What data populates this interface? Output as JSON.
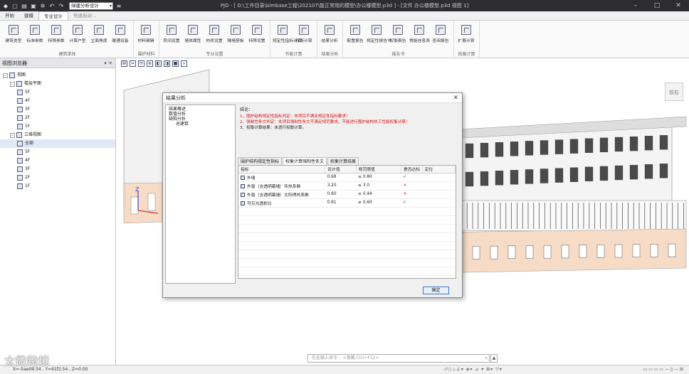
{
  "app": {
    "window_title": "PJD - [ D:\\工作目录\\bimbase工程\\202107\\能正常用的模型\\办公楼模型.p3d ] - [文件 办公楼模型.p3d 视图 1]",
    "workspace_combo": "绿建分析设计"
  },
  "tabs": [
    "开始",
    "建模",
    "专业设计",
    "快速启动..."
  ],
  "ribbon": {
    "groups": [
      {
        "label": "建筑单体",
        "buttons": [
          "建筑类型",
          "标准参数",
          "特殊参数",
          "计算户型",
          "立面角度",
          "暖通设备"
        ]
      },
      {
        "label": "围护材料",
        "buttons": [
          "材料编辑"
        ]
      },
      {
        "label": "专业设置",
        "buttons": [
          "房间设置",
          "墙体属性",
          "热桥设置",
          "隔墙搭板",
          "特殊设置"
        ]
      },
      {
        "label": "节能计算",
        "buttons": [
          "规定性指标计算",
          "权衡计算"
        ]
      },
      {
        "label": "结果分析",
        "buttons": [
          "结果分析"
        ]
      },
      {
        "label": "报告书",
        "buttons": [
          "配置报告",
          "规定性报告书",
          "权衡报告",
          "常能信息表",
          "查阅报告"
        ]
      },
      {
        "label": "拓展计算",
        "buttons": [
          "扩展计算"
        ]
      }
    ]
  },
  "browser": {
    "title": "视图浏览器",
    "tree": [
      {
        "label": "视图",
        "level": 0,
        "exp": "-"
      },
      {
        "label": "楼层平面",
        "level": 1,
        "exp": "-"
      },
      {
        "label": "5F",
        "level": 2
      },
      {
        "label": "4F",
        "level": 2
      },
      {
        "label": "3F",
        "level": 2
      },
      {
        "label": "2F",
        "level": 2
      },
      {
        "label": "1F",
        "level": 2
      },
      {
        "label": "三维视图",
        "level": 1,
        "exp": "-"
      },
      {
        "label": "全部",
        "level": 2,
        "selected": true
      },
      {
        "label": "5F",
        "level": 2
      },
      {
        "label": "4F",
        "level": 2
      },
      {
        "label": "3F",
        "level": 2
      },
      {
        "label": "2F",
        "level": 2
      },
      {
        "label": "1F",
        "level": 2
      }
    ]
  },
  "viewport": {
    "nav_cube": "前右",
    "axis_z": "Z",
    "command_placeholder": "在此输入命令... <隐藏:Ctrl+F12>"
  },
  "dialog": {
    "title": "结果分析",
    "nav": [
      {
        "label": "结果概述",
        "sub": false
      },
      {
        "label": "数值分析",
        "sub": false
      },
      {
        "label": "缺陷分析",
        "sub": false
      },
      {
        "label": "总建筑",
        "sub": true
      }
    ],
    "conclusion_header": "结论：",
    "conclusions": [
      {
        "text": "1、围护结构规定性指标判定：本项目不满足规定性指标要求！",
        "red": true
      },
      {
        "text": "2、强制性条文判定：本项目强制性条文不满足规范要求，不能进行围护结构热工性能权衡计算！",
        "red": true
      },
      {
        "text": "3、权衡计算结果：未进行权衡计算。",
        "red": false
      }
    ],
    "tabs": [
      "围护结构规定性指标",
      "权衡计算强制性条文",
      "权衡计算结果"
    ],
    "active_tab": 1,
    "table": {
      "headers": [
        "指标",
        "设计值",
        "规范限值",
        "是否达标",
        "定位"
      ],
      "rows": [
        {
          "name": "外墙",
          "design": "0.68",
          "limit": "≤ 0.80",
          "ok": "√",
          "pass": true
        },
        {
          "name": "外窗（含透明幕墙）传热系数",
          "design": "3.20",
          "limit": "≤ 3.0",
          "ok": "×",
          "pass": false
        },
        {
          "name": "外窗（含透明幕墙）太阳得热系数",
          "design": "0.60",
          "limit": "≤ 0.44",
          "ok": "×",
          "pass": false
        },
        {
          "name": "可见光透射比",
          "design": "0.81",
          "limit": "≥ 0.60",
          "ok": "√",
          "pass": true
        }
      ]
    },
    "ok_button": "确定"
  },
  "status": {
    "coords": "X=-5ae09.34 , Y=61f2.54 , Z=0.00"
  },
  "watermark": "太微跨境",
  "colors": {
    "titlebar": "#2d2d30",
    "fail_red": "#dd1111",
    "facade_peach": "#f6dcc6",
    "window_blue": "#3b79c6"
  }
}
